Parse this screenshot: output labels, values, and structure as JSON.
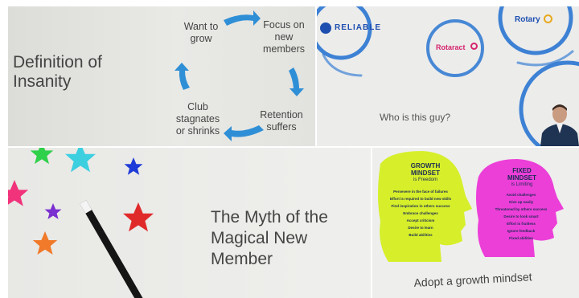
{
  "slide1": {
    "title_line1": "Definition of",
    "title_line2": "Insanity",
    "steps": {
      "want_line1": "Want to",
      "want_line2": "grow",
      "focus_line1": "Focus on",
      "focus_line2": "new",
      "focus_line3": "members",
      "retention_line1": "Retention",
      "retention_line2": "suffers",
      "club_line1": "Club",
      "club_line2": "stagnates",
      "club_line3": "or shrinks"
    },
    "arrow_color": "#2f8fd6"
  },
  "slide2": {
    "logo_reliable": "RELIABLE",
    "logo_rotaract": "Rotaract",
    "logo_rotary": "Rotary",
    "caption": "Who is this guy?",
    "ring_color": "#1e6fd0"
  },
  "slide3": {
    "title_line1": "The Myth of the",
    "title_line2": "Magical New",
    "title_line3": "Member",
    "stars": [
      "#2fd04a",
      "#3ccfe0",
      "#1f3bd8",
      "#f0337a",
      "#7a2fd0",
      "#e02a2a",
      "#f07a2a"
    ]
  },
  "slide4": {
    "growth_title_line1": "GROWTH",
    "growth_title_line2": "MINDSET",
    "growth_sub": "is Freedom",
    "growth_items": [
      "Persevere in the face of failures",
      "Effort is required to build new skills",
      "Find inspiration in others success",
      "Embrace challenges",
      "Accept criticism",
      "Desire to learn",
      "Build abilities"
    ],
    "fixed_title_line1": "FIXED",
    "fixed_title_line2": "MINDSET",
    "fixed_sub": "is Limiting",
    "fixed_items": [
      "Avoid challenges",
      "Give up easily",
      "Threatened by others success",
      "Desire to look smart",
      "Effort is fruitless",
      "Ignore feedback",
      "Fixed abilities"
    ],
    "caption": "Adopt a growth mindset",
    "growth_color": "#d6ef2a",
    "fixed_color": "#ec3fd8"
  }
}
